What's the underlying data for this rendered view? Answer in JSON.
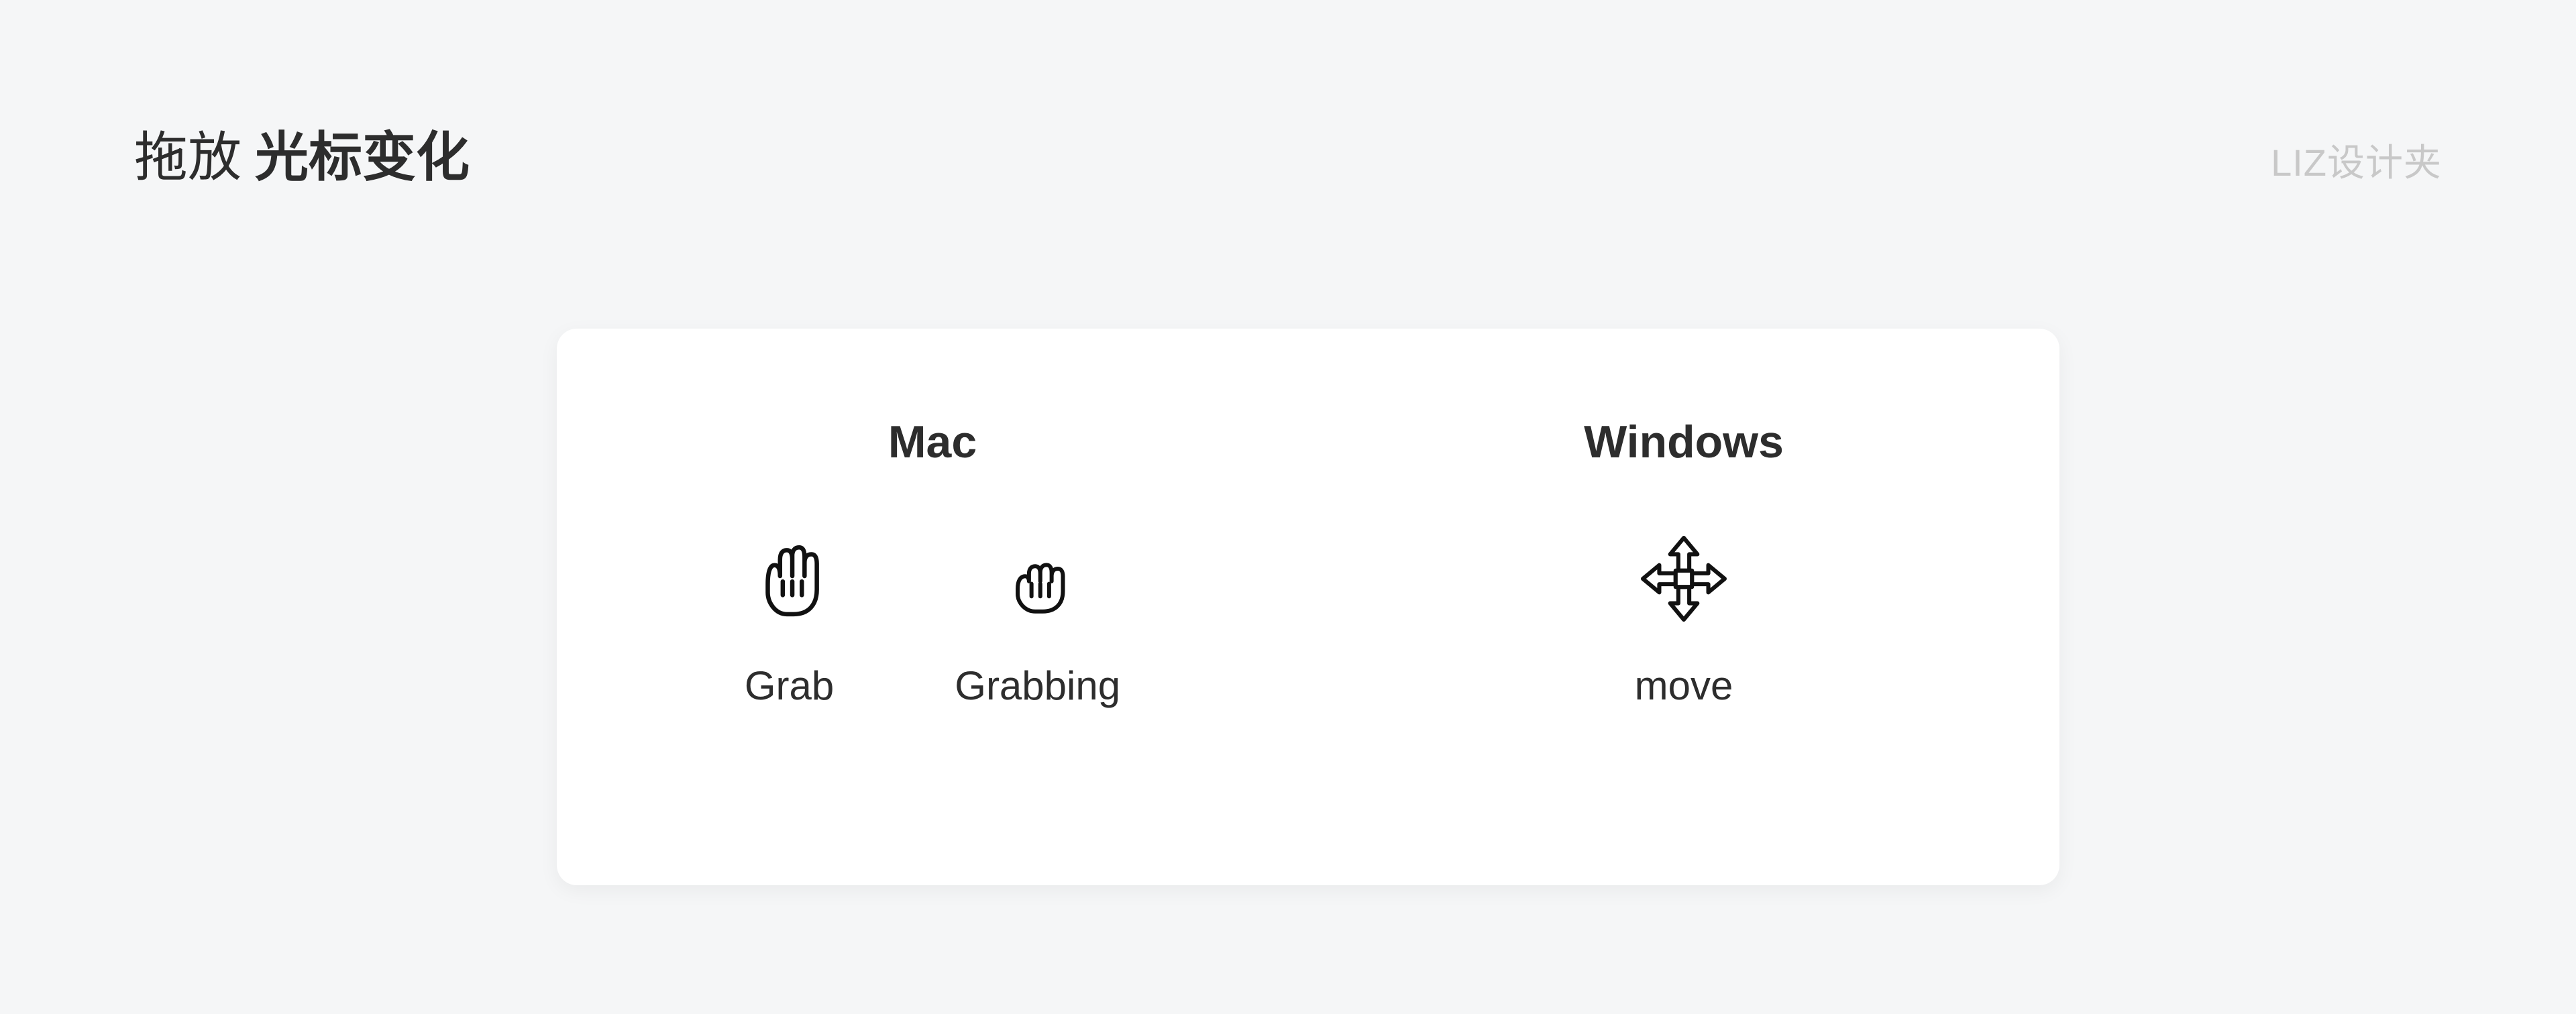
{
  "header": {
    "title_prefix": "拖放",
    "title_main": "光标变化",
    "watermark": "LIZ设计夹"
  },
  "card": {
    "columns": [
      {
        "heading": "Mac",
        "cursors": [
          {
            "label": "Grab",
            "icon": "grab-hand-icon"
          },
          {
            "label": "Grabbing",
            "icon": "grabbing-hand-icon"
          }
        ]
      },
      {
        "heading": "Windows",
        "cursors": [
          {
            "label": "move",
            "icon": "move-cursor-icon"
          }
        ]
      }
    ]
  }
}
